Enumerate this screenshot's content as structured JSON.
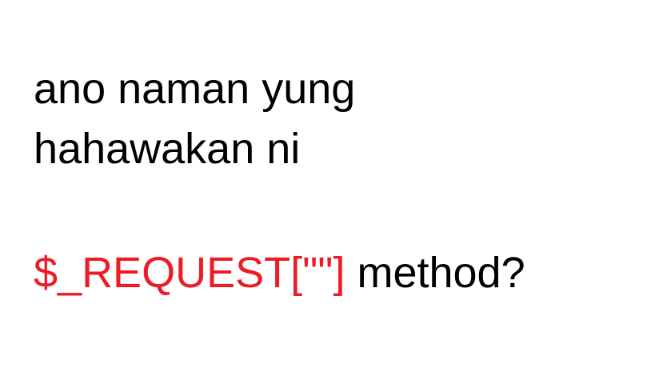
{
  "lines": {
    "line1": "ano naman yung",
    "line2": "hahawakan ni",
    "line3_code": "$_REQUEST[\"\"]",
    "line3_rest": " method?"
  },
  "colors": {
    "text": "#000000",
    "code": "#ed1c24",
    "background": "#ffffff"
  }
}
